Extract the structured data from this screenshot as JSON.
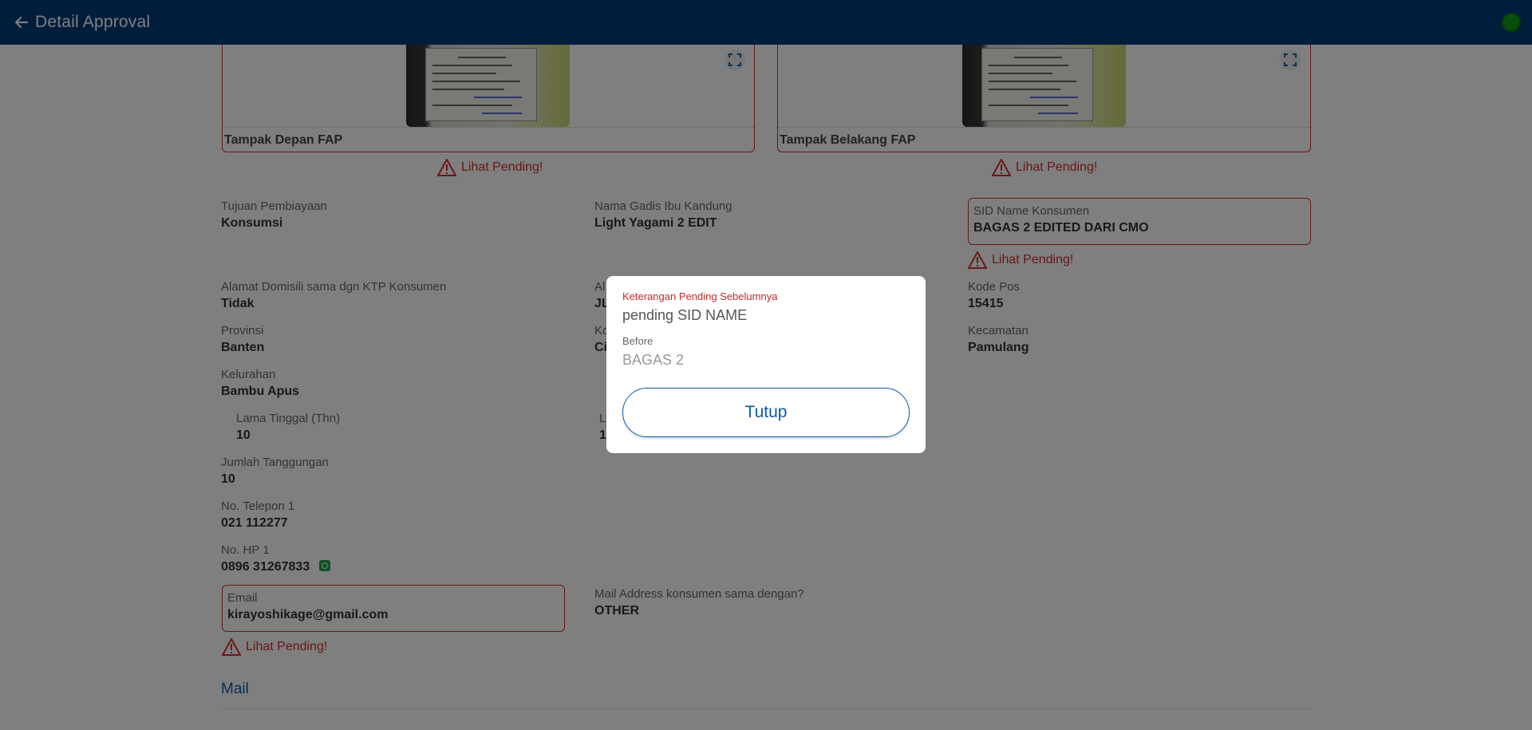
{
  "header": {
    "title": "Detail Approval",
    "back_icon": "arrow-left-icon",
    "status_color": "#119b17"
  },
  "documents": [
    {
      "caption": "Tampak Depan FAP",
      "pending_label": "Lihat Pending!"
    },
    {
      "caption": "Tampak Belakang FAP",
      "pending_label": "Lihat Pending!"
    }
  ],
  "fields": {
    "tujuan": {
      "label": "Tujuan Pembiayaan",
      "value": "Konsumsi"
    },
    "ibu": {
      "label": "Nama Gadis Ibu Kandung",
      "value": "Light Yagami 2 EDIT"
    },
    "sid": {
      "label": "SID Name Konsumen",
      "value": "BAGAS 2 EDITED DARI CMO",
      "pending_label": "Lihat Pending!"
    },
    "alamat_sama": {
      "label": "Alamat Domisili sama dgn KTP Konsumen",
      "value": "Tidak"
    },
    "alamat_partial": {
      "label": "Al",
      "value": "JL"
    },
    "kode_pos": {
      "label": "Kode Pos",
      "value": "15415"
    },
    "provinsi": {
      "label": "Provinsi",
      "value": "Banten"
    },
    "kota_partial": {
      "label": "Ko",
      "value": "Ci"
    },
    "kecamatan": {
      "label": "Kecamatan",
      "value": "Pamulang"
    },
    "kelurahan": {
      "label": "Kelurahan",
      "value": "Bambu Apus"
    },
    "lama_tinggal": {
      "label": "Lama Tinggal (Thn)",
      "value": "10"
    },
    "lama_partial": {
      "label": "L",
      "value": "1"
    },
    "tanggungan": {
      "label": "Jumlah Tanggungan",
      "value": "10"
    },
    "telepon": {
      "label": "No. Telepon 1",
      "value": "021 112277"
    },
    "hp": {
      "label": "No. HP 1",
      "value": "0896 31267833"
    },
    "email": {
      "label": "Email",
      "value": "kirayoshikage@gmail.com",
      "pending_label": "Lihat Pending!"
    },
    "mail_address": {
      "label": "Mail Address konsumen sama dengan?",
      "value": "OTHER"
    }
  },
  "section": {
    "title": "Mail"
  },
  "modal": {
    "title": "Keterangan Pending Sebelumnya",
    "text": "pending SID NAME",
    "before_label": "Before",
    "before_value": "BAGAS 2",
    "close_label": "Tutup"
  }
}
